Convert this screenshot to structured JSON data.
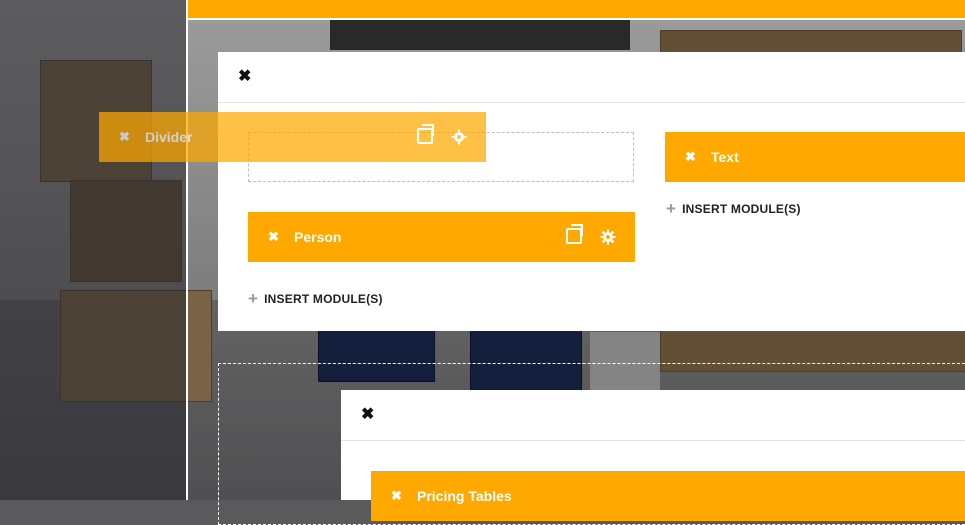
{
  "colors": {
    "accent": "#ffa800",
    "panel": "#ffffff",
    "text": "#222222"
  },
  "close_symbol": "✖",
  "row_panel": {
    "left_column": {
      "module": {
        "label": "Person"
      },
      "insert_label": "INSERT MODULE(S)"
    },
    "right_column": {
      "module": {
        "label": "Text"
      },
      "insert_label": "INSERT MODULE(S)"
    }
  },
  "dragging_module": {
    "label": "Divider"
  },
  "lower_panel": {
    "module": {
      "label": "Pricing Tables"
    }
  },
  "icons": [
    "close-icon",
    "duplicate-icon",
    "settings-gear-icon",
    "plus-icon"
  ]
}
